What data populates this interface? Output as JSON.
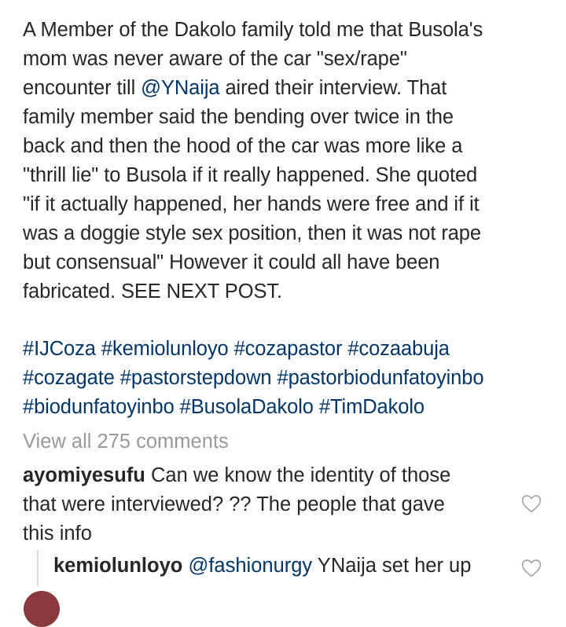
{
  "caption": {
    "line1": "A Member of the Dakolo family told me that Busola's",
    "line2": "mom was never aware of the car \"sex/rape\"",
    "line3_mention": "@YNaija",
    "line3_rest": " aired their interview. That",
    "line3_pre": "encounter till ",
    "line4": "family member said the bending over twice in the",
    "line5": "back and then the hood of the car was more like a",
    "line6": "\"thrill lie\" to Busola if it really happened. She quoted",
    "line7": "\"if it actually happened, her hands were free and if it",
    "line8": "was a doggie style sex position, then it was not rape",
    "line9": "but consensual\" However it could all have been",
    "line10": "fabricated. SEE NEXT POST."
  },
  "hashtags": {
    "row1": [
      "#IJCoza",
      "#kemiolunloyo",
      "#cozapastor",
      "#cozaabuja"
    ],
    "row2": [
      "#cozagate",
      "#pastorstepdown",
      "#pastorbiodunfatoyinbo"
    ],
    "row3": [
      "#biodunfatoyinbo",
      "#BusolaDakolo",
      "#TimDakolo"
    ]
  },
  "comments": {
    "view_all_label": "View all 275 comments",
    "first": {
      "username": "ayomiyesufu",
      "line1": " Can we know the identity of those",
      "line2": "that were interviewed? ?? The people that gave",
      "line3": "this info"
    },
    "reply": {
      "username": "kemiolunloyo",
      "mention": "@fashionurgy",
      "text": " YNaija set her up"
    }
  },
  "icons": {
    "like": "heart-outline-icon"
  },
  "colors": {
    "link": "#003569",
    "muted": "#999999",
    "text": "#262626"
  }
}
